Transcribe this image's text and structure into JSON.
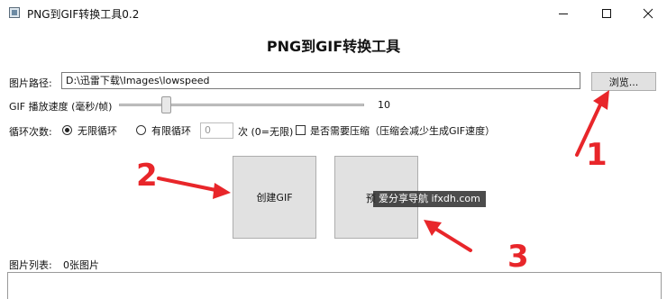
{
  "window": {
    "title": "PNG到GIF转换工具0.2",
    "minimize_icon": "minimize-icon",
    "maximize_icon": "maximize-icon",
    "close_icon": "close-icon"
  },
  "heading": "PNG到GIF转换工具",
  "path": {
    "label": "图片路径:",
    "value": "D:\\迅雷下载\\Images\\lowspeed",
    "browse_label": "浏览..."
  },
  "speed": {
    "label": "GIF 播放速度 (毫秒/帧)",
    "value": "10",
    "slider_fraction": 0.18
  },
  "loop": {
    "label": "循环次数:",
    "infinite_label": "无限循环",
    "finite_label": "有限循环",
    "count_placeholder": "0",
    "count_hint": "次 (0=无限)",
    "selected": "无限循环"
  },
  "compress": {
    "label": "是否需要压缩（压缩会减少生成GIF速度）",
    "checked": false
  },
  "actions": {
    "create_label": "创建GIF",
    "second_label": "预"
  },
  "watermark": "爱分享导航 ifxdh.com",
  "list": {
    "label": "图片列表:",
    "count": "0张图片"
  },
  "annotations": {
    "n1": "1",
    "n2": "2",
    "n3": "3",
    "color": "#e8262a"
  }
}
